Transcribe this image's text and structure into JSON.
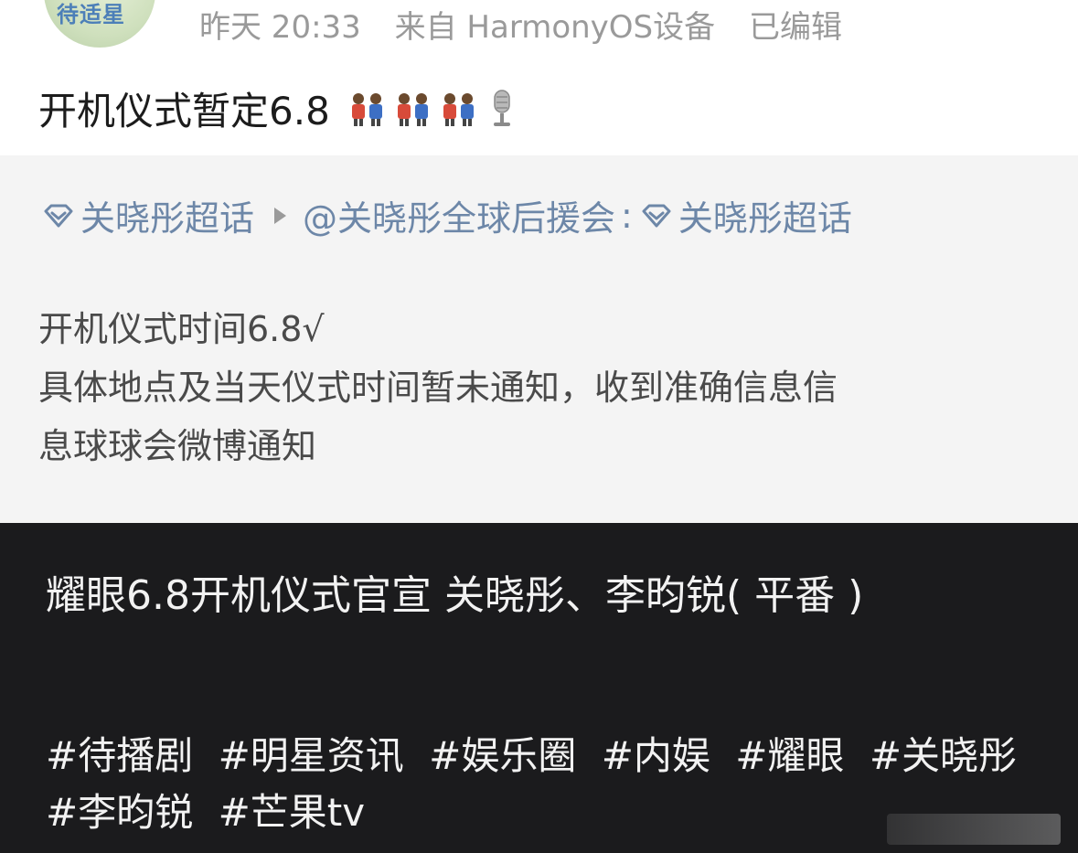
{
  "post": {
    "avatar_text": "待适星",
    "meta": {
      "time": "昨天 20:33",
      "source": "来自 HarmonyOS设备",
      "edited": "已编辑"
    },
    "title": "开机仪式暂定6.8",
    "emoji_icons": [
      "people-icon",
      "people-icon",
      "people-icon",
      "microphone-icon"
    ]
  },
  "repost": {
    "topic_left": "关晓彤超话",
    "author": "@关晓彤全球后援会",
    "colon": ":",
    "topic_right": "关晓彤超话",
    "lines": [
      "开机仪式时间6.8√",
      "具体地点及当天仪式时间暂未通知，收到准确信息信",
      "息球球会微博通知"
    ]
  },
  "caption": {
    "title": "耀眼6.8开机仪式官宣 关晓彤、李昀锐( 平番 )",
    "hashtags": [
      "#待播剧",
      "#明星资讯",
      "#娱乐圈",
      "#内娱",
      "#耀眼",
      "#关晓彤",
      "#李昀锐",
      "#芒果tv"
    ]
  },
  "colors": {
    "link": "#6d87a8",
    "meta": "#9a9a9a",
    "repost_bg": "#f4f4f4",
    "caption_bg": "#1b1b1d"
  }
}
